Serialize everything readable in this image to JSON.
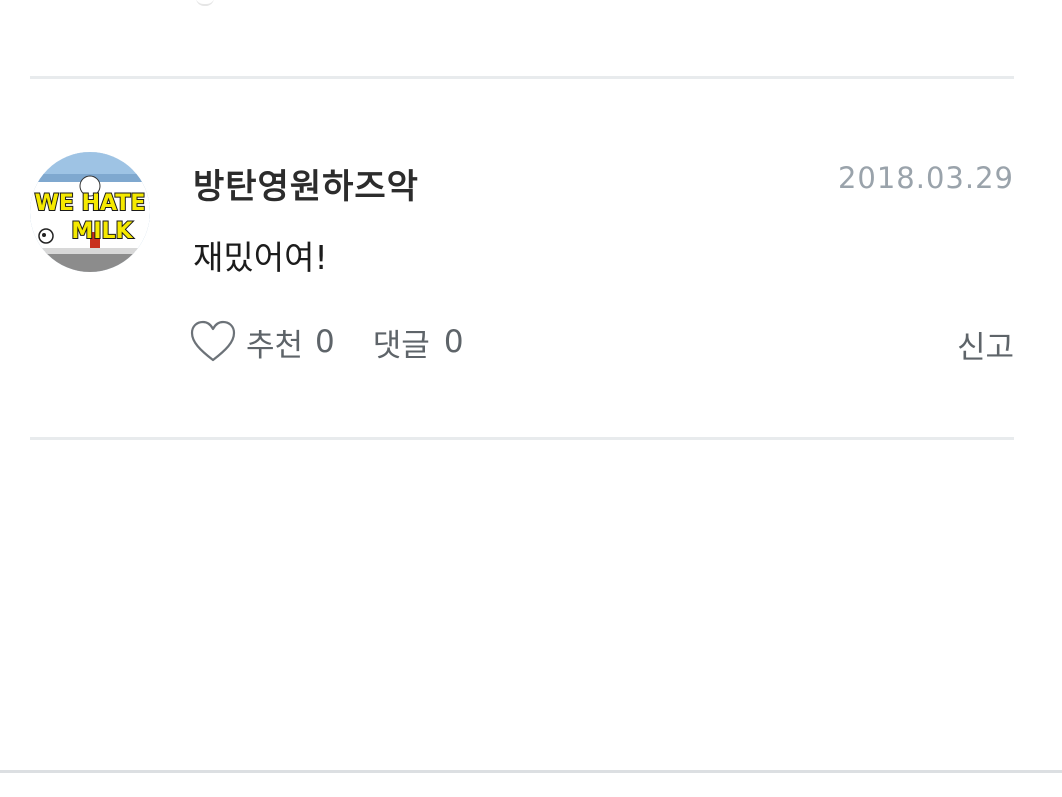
{
  "comment": {
    "username": "방탄영원하즈악",
    "date": "2018.03.29",
    "text": "재밌어여!",
    "avatar": {
      "alt_text_line1": "WE HATE",
      "alt_text_line2": "MILK"
    },
    "actions": {
      "like_label": "추천",
      "like_count": "0",
      "reply_label": "댓글",
      "reply_count": "0",
      "report_label": "신고"
    }
  },
  "icons": {
    "like": "heart-icon"
  },
  "colors": {
    "username": "#2c2c2c",
    "date": "#9aa3ab",
    "action_text": "#5e6469",
    "divider": "#e8ebed"
  }
}
